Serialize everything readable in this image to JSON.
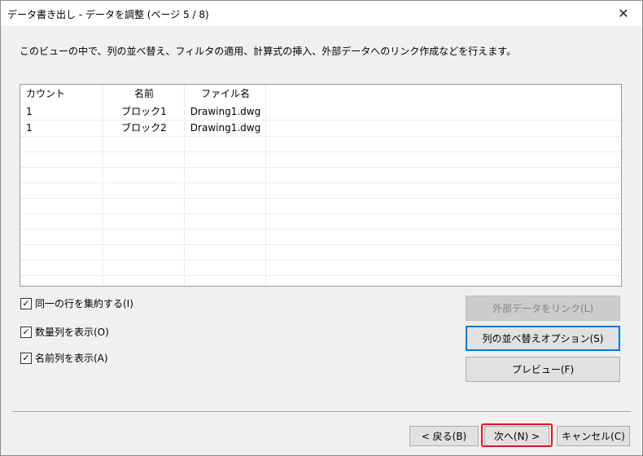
{
  "window": {
    "title": "データ書き出し - データを調整 (ページ 5 / 8)",
    "close_glyph": "✕"
  },
  "description": "このビューの中で、列の並べ替え、フィルタの適用、計算式の挿入、外部データへのリンク作成などを行えます。",
  "table": {
    "columns": [
      "カウント",
      "名前",
      "ファイル名"
    ],
    "rows": [
      [
        "1",
        "ブロック1",
        "Drawing1.dwg"
      ],
      [
        "1",
        "ブロック2",
        "Drawing1.dwg"
      ]
    ]
  },
  "options": [
    {
      "label": "同一の行を集約する(I)",
      "checked": true
    },
    {
      "label": "数量列を表示(O)",
      "checked": true
    },
    {
      "label": "名前列を表示(A)",
      "checked": true
    }
  ],
  "buttons": {
    "link_external": "外部データをリンク(L)",
    "sort_columns": "列の並べ替えオプション(S)",
    "preview": "プレビュー(F)",
    "back": "< 戻る(B)",
    "next": "次へ(N) >",
    "cancel": "キャンセル(C)"
  },
  "check_glyph": "✓",
  "colors": {
    "accent": "#0078d7",
    "highlight": "#e81123"
  }
}
